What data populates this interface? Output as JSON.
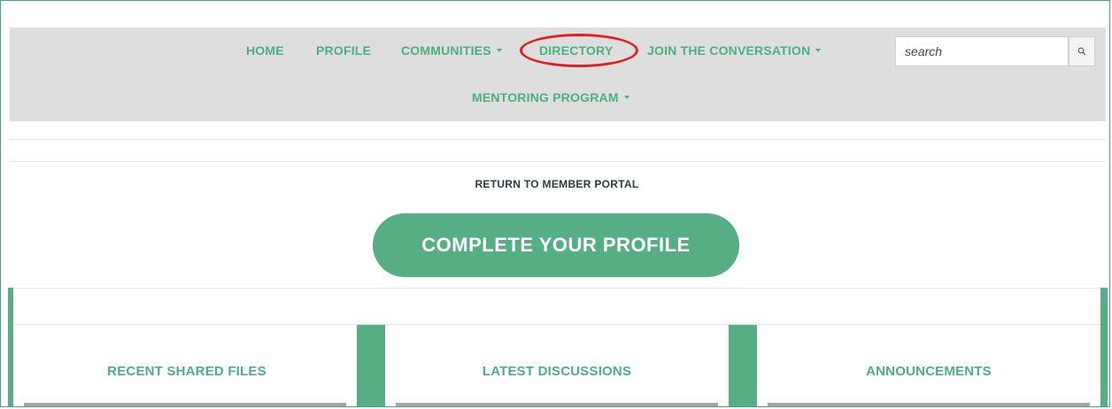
{
  "nav": {
    "items": [
      {
        "label": "HOME"
      },
      {
        "label": "PROFILE"
      },
      {
        "label": "COMMUNITIES"
      },
      {
        "label": "DIRECTORY"
      },
      {
        "label": "JOIN THE CONVERSATION"
      },
      {
        "label": "MENTORING PROGRAM"
      }
    ],
    "highlighted": "DIRECTORY",
    "highlight_color": "#e02020"
  },
  "search": {
    "placeholder": "search"
  },
  "main": {
    "return_link": "RETURN TO MEMBER PORTAL",
    "cta_label": "COMPLETE YOUR PROFILE"
  },
  "panels": [
    {
      "title": "RECENT SHARED FILES"
    },
    {
      "title": "LATEST DISCUSSIONS"
    },
    {
      "title": "ANNOUNCEMENTS"
    }
  ],
  "colors": {
    "accent": "#4caf84",
    "nav_background": "#dedede",
    "button": "#55ae84"
  }
}
